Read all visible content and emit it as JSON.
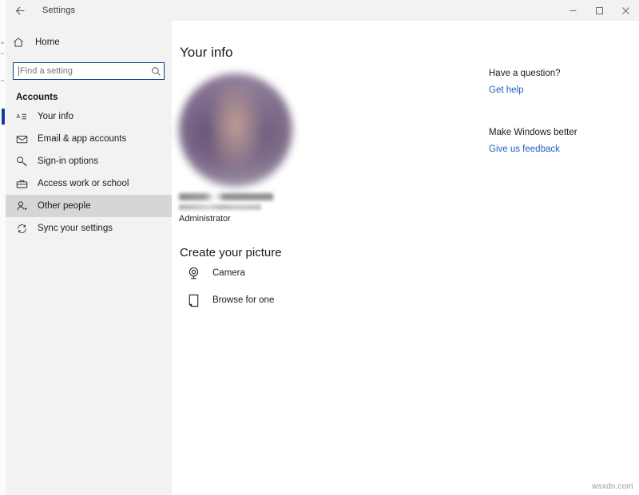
{
  "window": {
    "app_title": "Settings",
    "back_icon": "back-arrow-icon",
    "controls": {
      "minimize": "minimize-icon",
      "maximize": "maximize-icon",
      "close": "close-icon"
    }
  },
  "sidebar": {
    "home": {
      "label": "Home",
      "icon": "home-icon"
    },
    "search": {
      "value": "",
      "placeholder": "Find a setting",
      "icon": "search-icon"
    },
    "section_header": "Accounts",
    "items": [
      {
        "label": "Your info",
        "icon": "contact-card-icon",
        "selected": true,
        "hover": false
      },
      {
        "label": "Email & app accounts",
        "icon": "envelope-icon",
        "selected": false,
        "hover": false
      },
      {
        "label": "Sign-in options",
        "icon": "key-icon",
        "selected": false,
        "hover": false
      },
      {
        "label": "Access work or school",
        "icon": "briefcase-icon",
        "selected": false,
        "hover": false
      },
      {
        "label": "Other people",
        "icon": "person-add-icon",
        "selected": false,
        "hover": true
      },
      {
        "label": "Sync your settings",
        "icon": "sync-icon",
        "selected": false,
        "hover": false
      }
    ]
  },
  "main": {
    "page_title": "Your info",
    "avatar": {
      "icon": "user-avatar-image",
      "redacted": true
    },
    "account": {
      "display_name_redacted": true,
      "account_path_redacted": true,
      "role": "Administrator"
    },
    "create_picture": {
      "heading": "Create your picture",
      "options": [
        {
          "label": "Camera",
          "icon": "camera-icon"
        },
        {
          "label": "Browse for one",
          "icon": "browse-file-icon"
        }
      ]
    }
  },
  "help": {
    "groups": [
      {
        "heading": "Have a question?",
        "link": "Get help"
      },
      {
        "heading": "Make Windows better",
        "link": "Give us feedback"
      }
    ]
  },
  "watermark": "wsxdn.com",
  "colors": {
    "accent": "#0b3f9b",
    "link": "#1f5fbf",
    "sidebar_bg": "#f2f2f2",
    "hover_bg": "#d6d6d6",
    "content_bg": "#ffffff"
  }
}
